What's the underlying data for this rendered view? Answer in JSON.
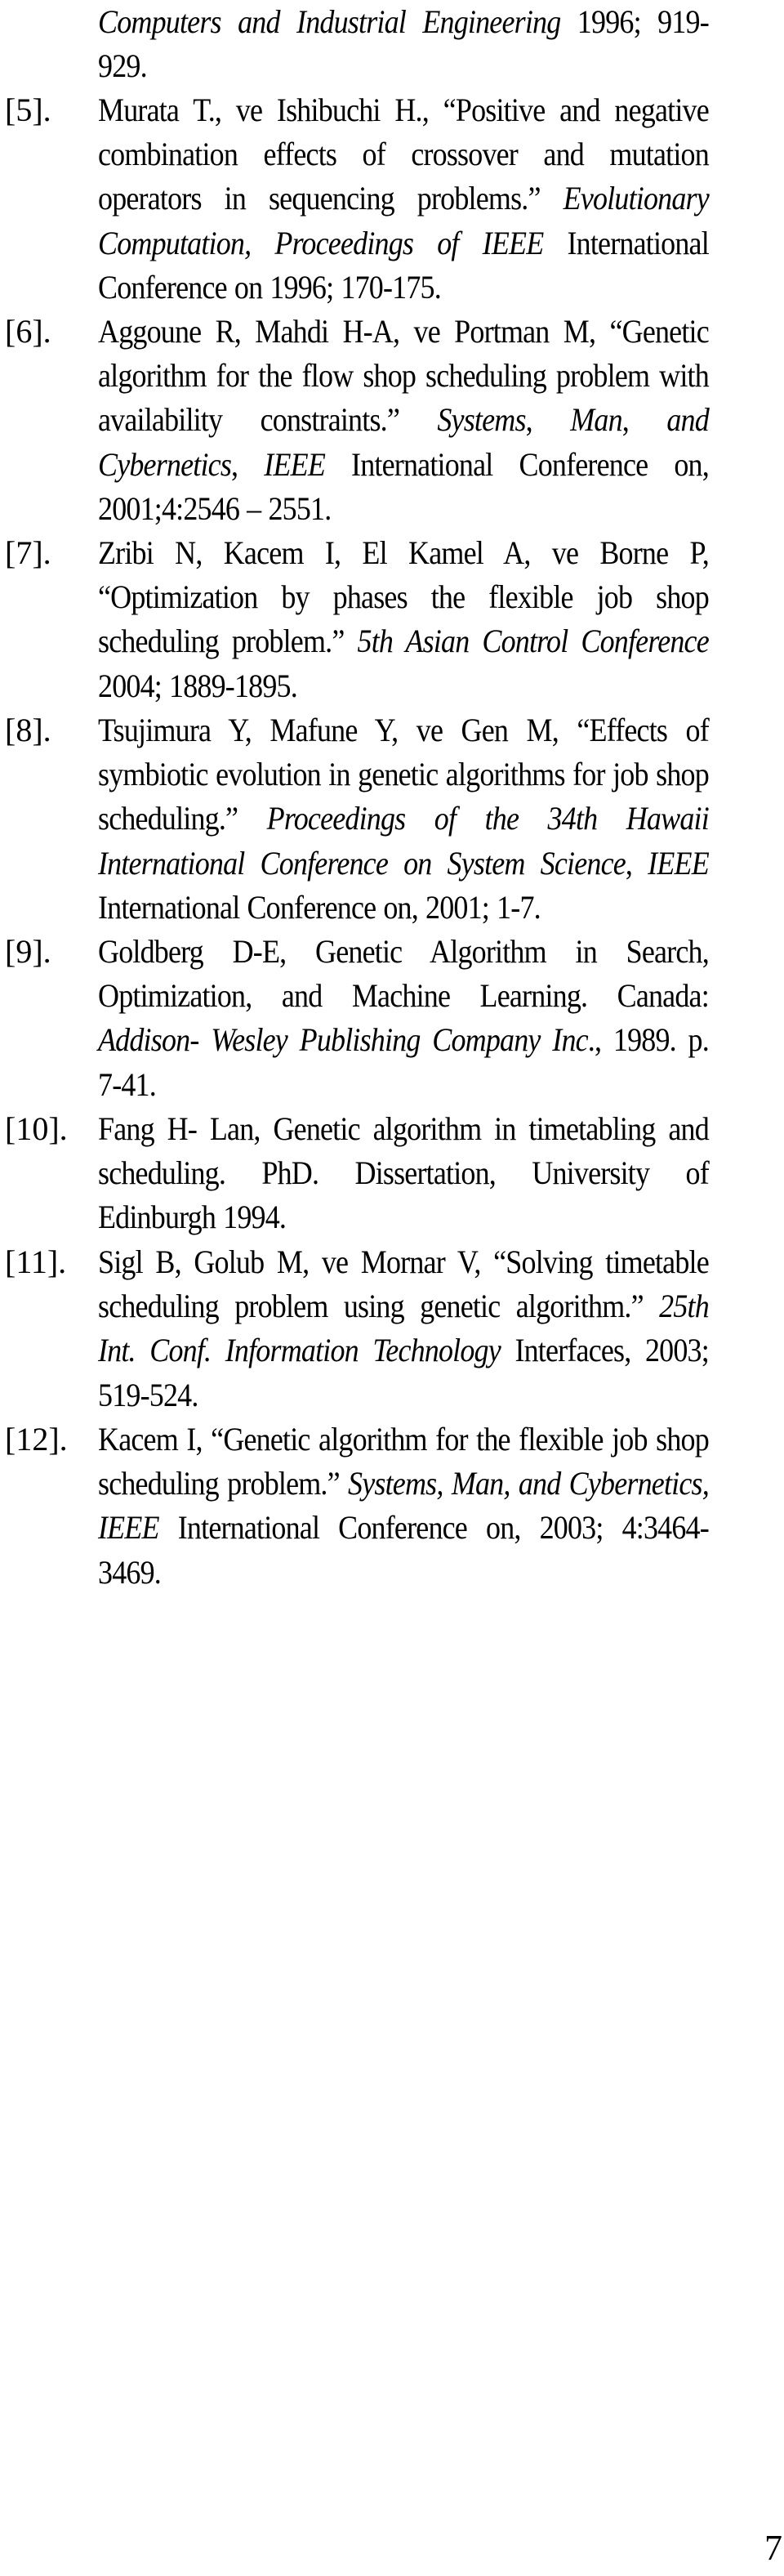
{
  "document": {
    "type": "references-continuation",
    "page_number": "7",
    "references": [
      {
        "label": "",
        "segments": [
          {
            "text": "Computers and Industrial Engineering",
            "italic": true
          },
          {
            "text": " 1996; 919-929.",
            "italic": false
          }
        ]
      },
      {
        "label": "[5].",
        "segments": [
          {
            "text": "Murata T., ve Ishibuchi H., “Positive and negative combination effects of crossover and mutation operators in sequencing problems.” ",
            "italic": false
          },
          {
            "text": "Evolutionary Computation, Proceedings of IEEE",
            "italic": true
          },
          {
            "text": " International Conference on 1996; 170-175.",
            "italic": false
          }
        ]
      },
      {
        "label": "[6].",
        "segments": [
          {
            "text": "Aggoune R, Mahdi H-A, ve Portman M, “Genetic algorithm for the flow shop scheduling problem with availability constraints.” ",
            "italic": false
          },
          {
            "text": "Systems",
            "italic": true
          },
          {
            "text": ", ",
            "italic": false
          },
          {
            "text": "Man",
            "italic": true
          },
          {
            "text": ", ",
            "italic": false
          },
          {
            "text": "and Cybernetics",
            "italic": true
          },
          {
            "text": ", ",
            "italic": false
          },
          {
            "text": "IEEE",
            "italic": true
          },
          {
            "text": " International Conference on, 2001;4:2546 – 2551.",
            "italic": false
          }
        ]
      },
      {
        "label": "[7].",
        "segments": [
          {
            "text": "Zribi N, Kacem I, El Kamel A, ve Borne P, “Optimization by phases the flexible job shop scheduling problem.” ",
            "italic": false
          },
          {
            "text": "5th Asian Control Conference",
            "italic": true
          },
          {
            "text": " 2004; 1889-1895.",
            "italic": false
          }
        ]
      },
      {
        "label": "[8].",
        "segments": [
          {
            "text": "Tsujimura Y, Mafune Y, ve Gen M, “Effects of symbiotic evolution in genetic algorithms for job shop scheduling.” ",
            "italic": false
          },
          {
            "text": "Proceedings of the 34th Hawaii International Conference on System Science",
            "italic": true
          },
          {
            "text": ", ",
            "italic": false
          },
          {
            "text": "IEEE",
            "italic": true
          },
          {
            "text": " International Conference on, 2001; 1-7.",
            "italic": false
          }
        ]
      },
      {
        "label": "[9].",
        "segments": [
          {
            "text": "Goldberg D-E, Genetic Algorithm in Search, Optimization, and Machine Learning. Canada: ",
            "italic": false
          },
          {
            "text": "Addison- Wesley Publishing Company Inc",
            "italic": true
          },
          {
            "text": "., 1989. p. 7-41.",
            "italic": false
          }
        ]
      },
      {
        "label": "[10].",
        "segments": [
          {
            "text": "Fang H- Lan, Genetic algorithm in timetabling and scheduling. PhD. Dissertation, University of Edinburgh 1994.",
            "italic": false
          }
        ]
      },
      {
        "label": "[11].",
        "segments": [
          {
            "text": "Sigl B, Golub M, ve Mornar V, “Solving timetable scheduling problem using genetic algorithm.” ",
            "italic": false
          },
          {
            "text": "25th Int. Conf. Information Technology",
            "italic": true
          },
          {
            "text": " Interfaces, 2003; 519-524.",
            "italic": false
          }
        ]
      },
      {
        "label": "[12].",
        "segments": [
          {
            "text": "Kacem I, “Genetic algorithm for the flexible job shop scheduling problem.” ",
            "italic": false
          },
          {
            "text": "Systems, Man, and Cybernetics, IEEE",
            "italic": true
          },
          {
            "text": " International Conference on, 2003; 4:3464-3469.",
            "italic": false
          }
        ]
      }
    ]
  }
}
